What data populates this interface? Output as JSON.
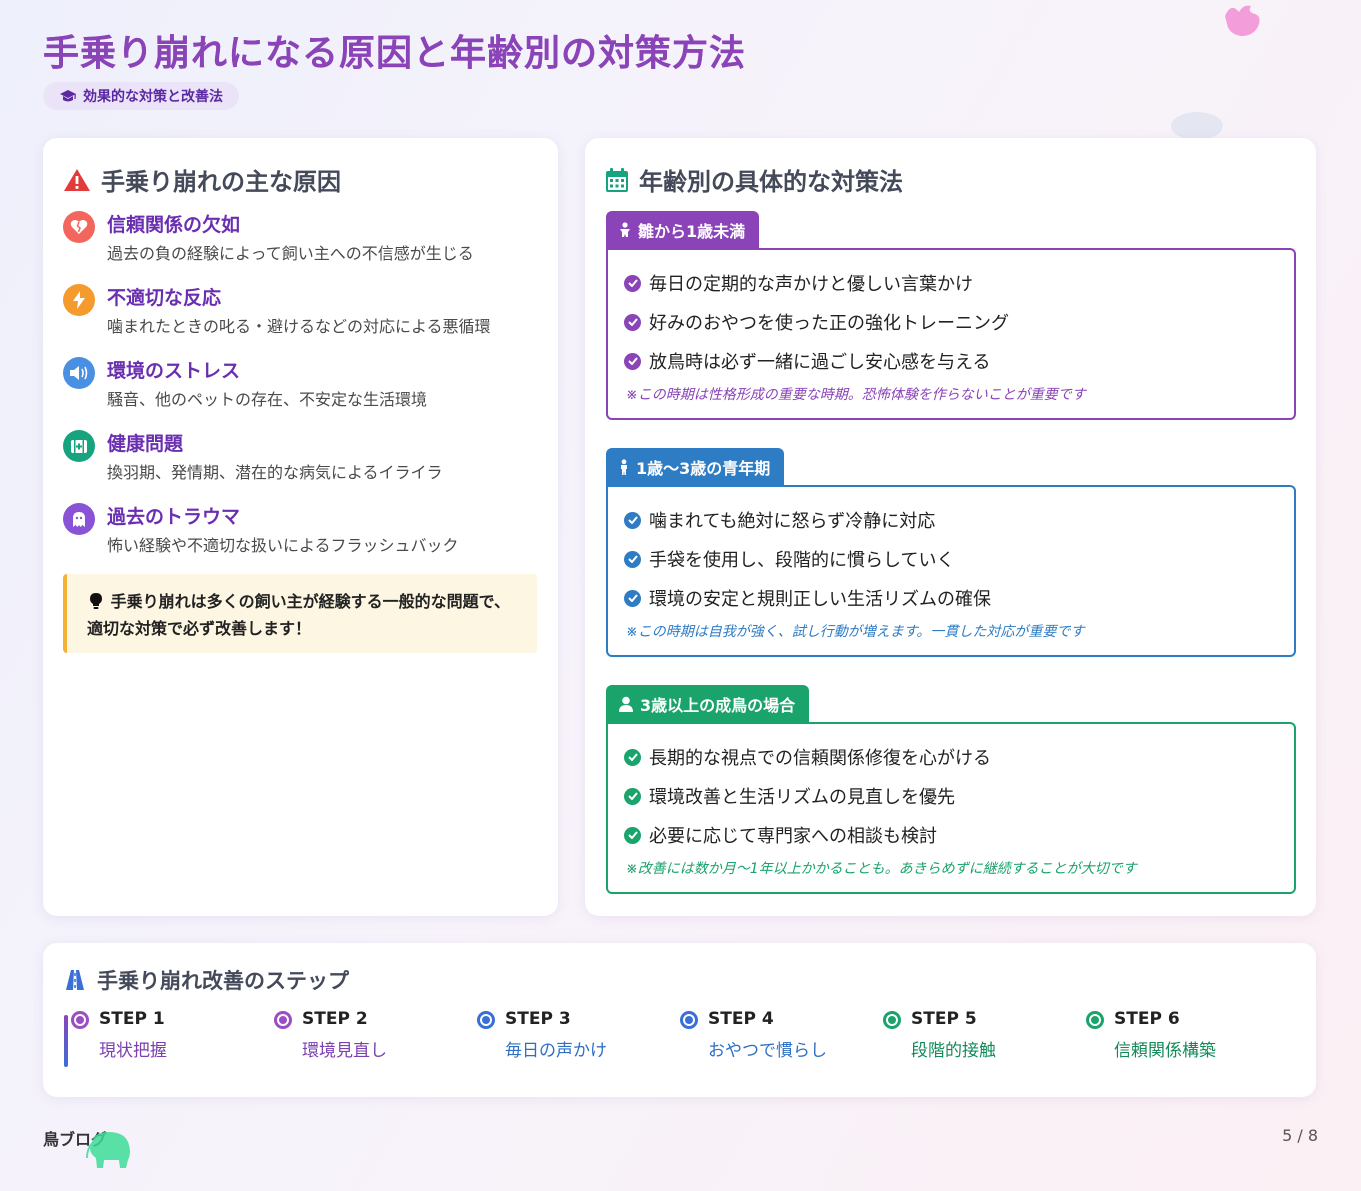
{
  "header": {
    "title": "手乗り崩れになる原因と年齢別の対策方法",
    "badge": "効果的な対策と改善法",
    "badge_icon": "graduation-cap-icon"
  },
  "causes": {
    "title": "手乗り崩れの主な原因",
    "title_icon": "warning-icon",
    "items": [
      {
        "title": "信頼関係の欠如",
        "desc": "過去の負の経験によって飼い主への不信感が生じる",
        "icon": "broken-heart-icon",
        "color": "#f2665e"
      },
      {
        "title": "不適切な反応",
        "desc": "噛まれたときの叱る・避けるなどの対応による悪循環",
        "icon": "bolt-icon",
        "color": "#f59a2c"
      },
      {
        "title": "環境のストレス",
        "desc": "騒音、他のペットの存在、不安定な生活環境",
        "icon": "volume-icon",
        "color": "#4a90e2"
      },
      {
        "title": "健康問題",
        "desc": "換羽期、発情期、潜在的な病気によるイライラ",
        "icon": "medical-kit-icon",
        "color": "#16a37e"
      },
      {
        "title": "過去のトラウマ",
        "desc": "怖い経験や不適切な扱いによるフラッシュバック",
        "icon": "ghost-icon",
        "color": "#8a52d6"
      }
    ],
    "tip": "手乗り崩れは多くの飼い主が経験する一般的な問題で、適切な対策で必ず改善します！",
    "tip_icon": "lightbulb-icon"
  },
  "ages": {
    "title": "年齢別の具体的な対策法",
    "title_icon": "calendar-icon",
    "groups": [
      {
        "tab": "雛から1歳未満",
        "icon": "baby-icon",
        "color": "#8a44b8",
        "items": [
          "毎日の定期的な声かけと優しい言葉かけ",
          "好みのおやつを使った正の強化トレーニング",
          "放鳥時は必ず一緒に過ごし安心感を与える"
        ],
        "note": "※この時期は性格形成の重要な時期。恐怖体験を作らないことが重要です"
      },
      {
        "tab": "1歳〜3歳の青年期",
        "icon": "child-icon",
        "color": "#2e7cc4",
        "items": [
          "噛まれても絶対に怒らず冷静に対応",
          "手袋を使用し、段階的に慣らしていく",
          "環境の安定と規則正しい生活リズムの確保"
        ],
        "note": "※この時期は自我が強く、試し行動が増えます。一貫した対応が重要です"
      },
      {
        "tab": "3歳以上の成鳥の場合",
        "icon": "user-icon",
        "color": "#1aa36a",
        "items": [
          "長期的な視点での信頼関係修復を心がける",
          "環境改善と生活リズムの見直しを優先",
          "必要に応じて専門家への相談も検討"
        ],
        "note": "※改善には数か月〜1年以上かかることも。あきらめずに継続することが大切です"
      }
    ]
  },
  "steps": {
    "title": "手乗り崩れ改善のステップ",
    "title_icon": "road-icon",
    "items": [
      {
        "label": "STEP 1",
        "sub": "現状把握",
        "color": "#9b4dc4"
      },
      {
        "label": "STEP 2",
        "sub": "環境見直し",
        "color": "#9b4dc4"
      },
      {
        "label": "STEP 3",
        "sub": "毎日の声かけ",
        "color": "#3a6fd8"
      },
      {
        "label": "STEP 4",
        "sub": "おやつで慣らし",
        "color": "#3a6fd8"
      },
      {
        "label": "STEP 5",
        "sub": "段階的接触",
        "color": "#1aa36a"
      },
      {
        "label": "STEP 6",
        "sub": "信頼関係構築",
        "color": "#1aa36a"
      }
    ]
  },
  "footer": {
    "brand": "鳥ブログ",
    "page": "5 / 8"
  }
}
